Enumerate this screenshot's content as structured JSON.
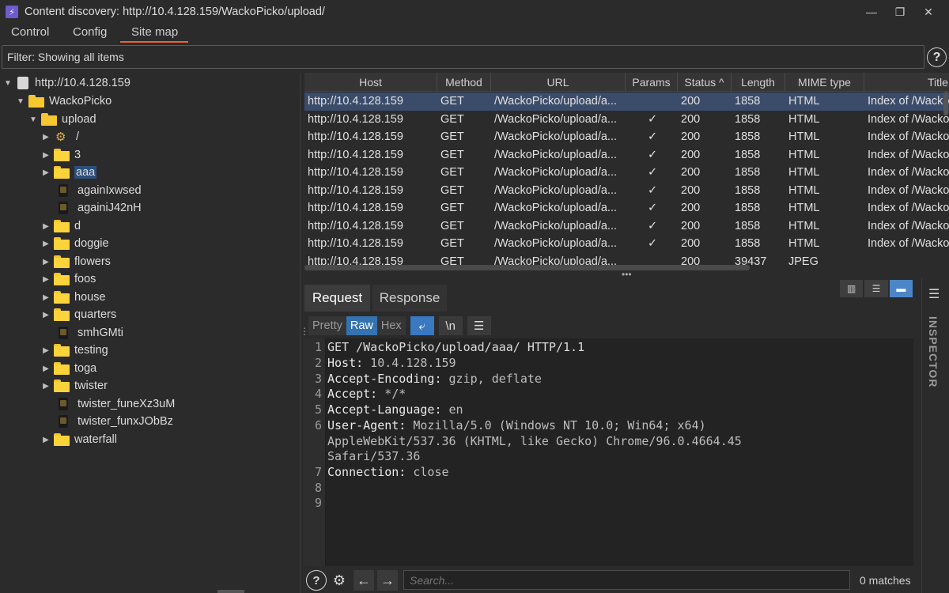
{
  "window": {
    "title": "Content discovery: http://10.4.128.159/WackoPicko/upload/",
    "app_icon": "burp-icon",
    "minimize": "—",
    "maximize": "❐",
    "close": "✕"
  },
  "tabs": [
    {
      "label": "Control"
    },
    {
      "label": "Config"
    },
    {
      "label": "Site map",
      "active": true
    }
  ],
  "filter": {
    "text": "Filter: Showing all items",
    "help": "?"
  },
  "tree": {
    "host": "http://10.4.128.159",
    "root_folder": "WackoPicko",
    "sub_folder": "upload",
    "items": [
      {
        "label": "/",
        "type": "gear"
      },
      {
        "label": "3",
        "type": "folder"
      },
      {
        "label": "aaa",
        "type": "folder",
        "selected": true
      },
      {
        "label": "againIxwsed",
        "type": "file"
      },
      {
        "label": "againiJ42nH",
        "type": "file"
      },
      {
        "label": "d",
        "type": "folder"
      },
      {
        "label": "doggie",
        "type": "folder"
      },
      {
        "label": "flowers",
        "type": "folder"
      },
      {
        "label": "foos",
        "type": "folder"
      },
      {
        "label": "house",
        "type": "folder"
      },
      {
        "label": "quarters",
        "type": "folder"
      },
      {
        "label": "smhGMti",
        "type": "file"
      },
      {
        "label": "testing",
        "type": "folder"
      },
      {
        "label": "toga",
        "type": "folder"
      },
      {
        "label": "twister",
        "type": "folder"
      },
      {
        "label": "twister_funeXz3uM",
        "type": "file"
      },
      {
        "label": "twister_funxJObBz",
        "type": "file"
      },
      {
        "label": "waterfall",
        "type": "folder"
      }
    ]
  },
  "table": {
    "columns": [
      "Host",
      "Method",
      "URL",
      "Params",
      "Status ^",
      "Length",
      "MIME type",
      "Title"
    ],
    "rows": [
      {
        "host": "http://10.4.128.159",
        "method": "GET",
        "url": "/WackoPicko/upload/a...",
        "params": "",
        "status": "200",
        "length": "1858",
        "mime": "HTML",
        "title": "Index of /Wacko",
        "selected": true
      },
      {
        "host": "http://10.4.128.159",
        "method": "GET",
        "url": "/WackoPicko/upload/a...",
        "params": "✓",
        "status": "200",
        "length": "1858",
        "mime": "HTML",
        "title": "Index of /Wacko"
      },
      {
        "host": "http://10.4.128.159",
        "method": "GET",
        "url": "/WackoPicko/upload/a...",
        "params": "✓",
        "status": "200",
        "length": "1858",
        "mime": "HTML",
        "title": "Index of /Wacko"
      },
      {
        "host": "http://10.4.128.159",
        "method": "GET",
        "url": "/WackoPicko/upload/a...",
        "params": "✓",
        "status": "200",
        "length": "1858",
        "mime": "HTML",
        "title": "Index of /Wacko"
      },
      {
        "host": "http://10.4.128.159",
        "method": "GET",
        "url": "/WackoPicko/upload/a...",
        "params": "✓",
        "status": "200",
        "length": "1858",
        "mime": "HTML",
        "title": "Index of /Wacko"
      },
      {
        "host": "http://10.4.128.159",
        "method": "GET",
        "url": "/WackoPicko/upload/a...",
        "params": "✓",
        "status": "200",
        "length": "1858",
        "mime": "HTML",
        "title": "Index of /Wacko"
      },
      {
        "host": "http://10.4.128.159",
        "method": "GET",
        "url": "/WackoPicko/upload/a...",
        "params": "✓",
        "status": "200",
        "length": "1858",
        "mime": "HTML",
        "title": "Index of /Wacko"
      },
      {
        "host": "http://10.4.128.159",
        "method": "GET",
        "url": "/WackoPicko/upload/a...",
        "params": "✓",
        "status": "200",
        "length": "1858",
        "mime": "HTML",
        "title": "Index of /Wacko"
      },
      {
        "host": "http://10.4.128.159",
        "method": "GET",
        "url": "/WackoPicko/upload/a...",
        "params": "✓",
        "status": "200",
        "length": "1858",
        "mime": "HTML",
        "title": "Index of /Wacko"
      },
      {
        "host": "http://10.4.128.159",
        "method": "GET",
        "url": "/WackoPicko/upload/a...",
        "params": "",
        "status": "200",
        "length": "39437",
        "mime": "JPEG",
        "title": ""
      }
    ]
  },
  "message": {
    "tabs": [
      "Request",
      "Response"
    ],
    "view_modes": [
      "Pretty",
      "Raw",
      "Hex"
    ],
    "active_view": "Raw",
    "newline_btn": "\\n",
    "lines": [
      {
        "n": "1",
        "text": "GET /WackoPicko/upload/aaa/ HTTP/1.1"
      },
      {
        "n": "2",
        "key": "Host:",
        "val": " 10.4.128.159"
      },
      {
        "n": "3",
        "key": "Accept-Encoding:",
        "val": " gzip, deflate"
      },
      {
        "n": "4",
        "key": "Accept:",
        "val": " */*"
      },
      {
        "n": "5",
        "key": "Accept-Language:",
        "val": " en"
      },
      {
        "n": "6",
        "key": "User-Agent:",
        "val": " Mozilla/5.0 (Windows NT 10.0; Win64; x64)"
      },
      {
        "n": "",
        "key": "",
        "val": "AppleWebKit/537.36 (KHTML, like Gecko) Chrome/96.0.4664.45"
      },
      {
        "n": "",
        "key": "",
        "val": "Safari/537.36"
      },
      {
        "n": "7",
        "key": "Connection:",
        "val": " close"
      },
      {
        "n": "8",
        "text": ""
      },
      {
        "n": "9",
        "text": ""
      }
    ]
  },
  "search": {
    "placeholder": "Search...",
    "matches": "0 matches"
  },
  "inspector": {
    "label": "INSPECTOR"
  },
  "colors": {
    "accent_tab_underline": "#e8613a",
    "selected_row": "#3b4c6b",
    "active_button": "#3572b0",
    "folder": "#fcd33b"
  }
}
